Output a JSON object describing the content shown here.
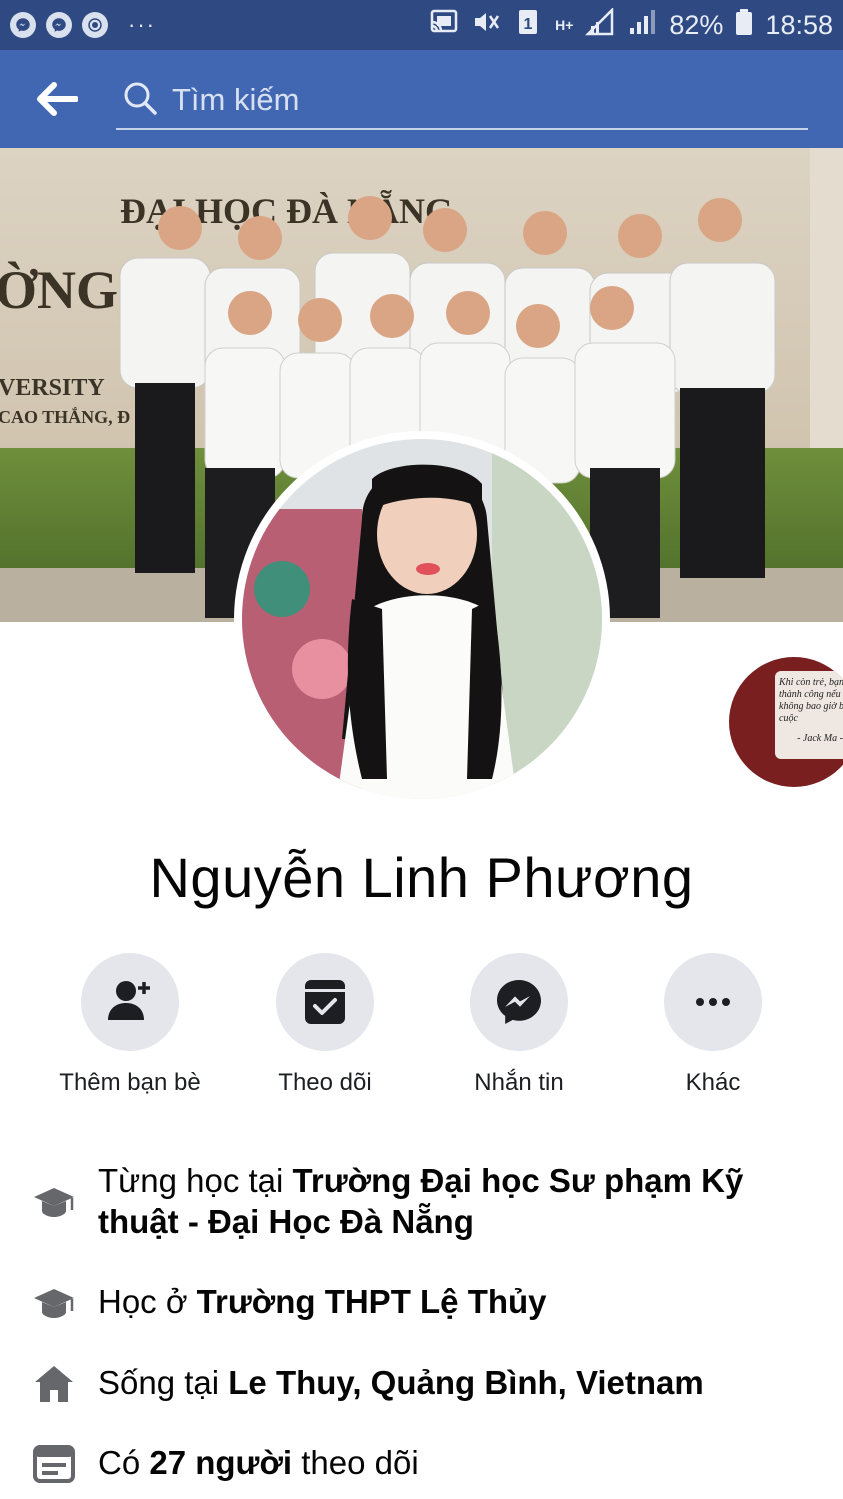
{
  "status_bar": {
    "battery": "82%",
    "time": "18:58",
    "network": "H+",
    "sim": "1",
    "dots": "···"
  },
  "header": {
    "search_placeholder": "Tìm kiếm"
  },
  "cover": {
    "sign_line1": "ĐẠI HỌC ĐÀ NẴNG",
    "sign_line2": "ỜNG Đ",
    "sign_line3": "VERSITY",
    "sign_line4": "CAO THẮNG, Đ"
  },
  "mini_avatar": {
    "quote": "Khi còn trẻ, bạn sẽ thành công nếu bạn không bao giờ bỏ cuộc",
    "author": "- Jack Ma -"
  },
  "profile": {
    "name": "Nguyễn Linh Phương"
  },
  "actions": [
    {
      "label": "Thêm bạn bè",
      "icon": "add-friend-icon"
    },
    {
      "label": "Theo dõi",
      "icon": "follow-icon"
    },
    {
      "label": "Nhắn tin",
      "icon": "messenger-icon"
    },
    {
      "label": "Khác",
      "icon": "more-icon"
    }
  ],
  "intro": [
    {
      "prefix": "Từng học tại ",
      "bold": "Trường Đại học Sư phạm Kỹ thuật - Đại Học Đà Nẵng",
      "suffix": "",
      "icon": "graduation-cap-icon"
    },
    {
      "prefix": "Học ở ",
      "bold": "Trường THPT Lệ Thủy",
      "suffix": "",
      "icon": "graduation-cap-icon"
    },
    {
      "prefix": "Sống tại ",
      "bold": "Le Thuy, Quảng Bình, Vietnam",
      "suffix": "",
      "icon": "home-icon"
    },
    {
      "prefix": "Có ",
      "bold": "27 người",
      "suffix": " theo dõi",
      "icon": "followers-icon"
    }
  ],
  "colors": {
    "status_bar": "#2f4a82",
    "header": "#4267b2",
    "button_bg": "#e4e6eb",
    "icon_dark": "#1c1e21"
  }
}
